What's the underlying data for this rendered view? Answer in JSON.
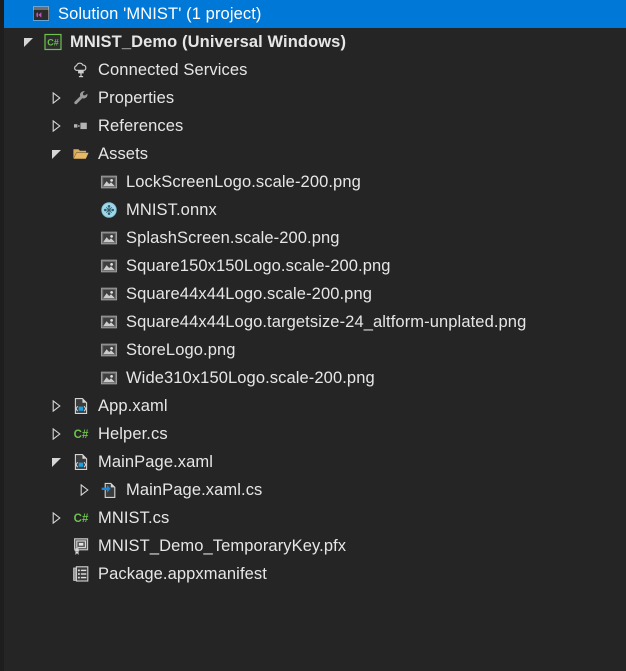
{
  "window": {
    "name": "solution-explorer",
    "background": "#252526",
    "selection_color": "#0078d7",
    "text_color": "#e6e6e6"
  },
  "tree": {
    "nodes": [
      {
        "label": "Solution 'MNIST' (1 project)",
        "icon": "solution-icon",
        "depth": 0,
        "expander": "none",
        "selected": true,
        "bold": false
      },
      {
        "label": "MNIST_Demo (Universal Windows)",
        "icon": "csharp-project-icon",
        "depth": 1,
        "expander": "expanded",
        "selected": false,
        "bold": true
      },
      {
        "label": "Connected Services",
        "icon": "connected-services-icon",
        "depth": 2,
        "expander": "none",
        "selected": false,
        "bold": false
      },
      {
        "label": "Properties",
        "icon": "wrench-icon",
        "depth": 2,
        "expander": "collapsed",
        "selected": false,
        "bold": false
      },
      {
        "label": "References",
        "icon": "references-icon",
        "depth": 2,
        "expander": "collapsed",
        "selected": false,
        "bold": false
      },
      {
        "label": "Assets",
        "icon": "folder-open-icon",
        "depth": 2,
        "expander": "expanded",
        "selected": false,
        "bold": false
      },
      {
        "label": "LockScreenLogo.scale-200.png",
        "icon": "image-file-icon",
        "depth": 3,
        "expander": "none",
        "selected": false,
        "bold": false
      },
      {
        "label": "MNIST.onnx",
        "icon": "onnx-model-icon",
        "depth": 3,
        "expander": "none",
        "selected": false,
        "bold": false
      },
      {
        "label": "SplashScreen.scale-200.png",
        "icon": "image-file-icon",
        "depth": 3,
        "expander": "none",
        "selected": false,
        "bold": false
      },
      {
        "label": "Square150x150Logo.scale-200.png",
        "icon": "image-file-icon",
        "depth": 3,
        "expander": "none",
        "selected": false,
        "bold": false
      },
      {
        "label": "Square44x44Logo.scale-200.png",
        "icon": "image-file-icon",
        "depth": 3,
        "expander": "none",
        "selected": false,
        "bold": false
      },
      {
        "label": "Square44x44Logo.targetsize-24_altform-unplated.png",
        "icon": "image-file-icon",
        "depth": 3,
        "expander": "none",
        "selected": false,
        "bold": false
      },
      {
        "label": "StoreLogo.png",
        "icon": "image-file-icon",
        "depth": 3,
        "expander": "none",
        "selected": false,
        "bold": false
      },
      {
        "label": "Wide310x150Logo.scale-200.png",
        "icon": "image-file-icon",
        "depth": 3,
        "expander": "none",
        "selected": false,
        "bold": false
      },
      {
        "label": "App.xaml",
        "icon": "xaml-file-icon",
        "depth": 2,
        "expander": "collapsed",
        "selected": false,
        "bold": false
      },
      {
        "label": "Helper.cs",
        "icon": "csharp-file-icon",
        "depth": 2,
        "expander": "collapsed",
        "selected": false,
        "bold": false
      },
      {
        "label": "MainPage.xaml",
        "icon": "xaml-file-icon",
        "depth": 2,
        "expander": "expanded",
        "selected": false,
        "bold": false
      },
      {
        "label": "MainPage.xaml.cs",
        "icon": "code-behind-file-icon",
        "depth": 3,
        "expander": "collapsed",
        "selected": false,
        "bold": false
      },
      {
        "label": "MNIST.cs",
        "icon": "csharp-file-icon",
        "depth": 2,
        "expander": "collapsed",
        "selected": false,
        "bold": false
      },
      {
        "label": "MNIST_Demo_TemporaryKey.pfx",
        "icon": "certificate-icon",
        "depth": 2,
        "expander": "none",
        "selected": false,
        "bold": false
      },
      {
        "label": "Package.appxmanifest",
        "icon": "manifest-icon",
        "depth": 2,
        "expander": "none",
        "selected": false,
        "bold": false
      }
    ]
  }
}
